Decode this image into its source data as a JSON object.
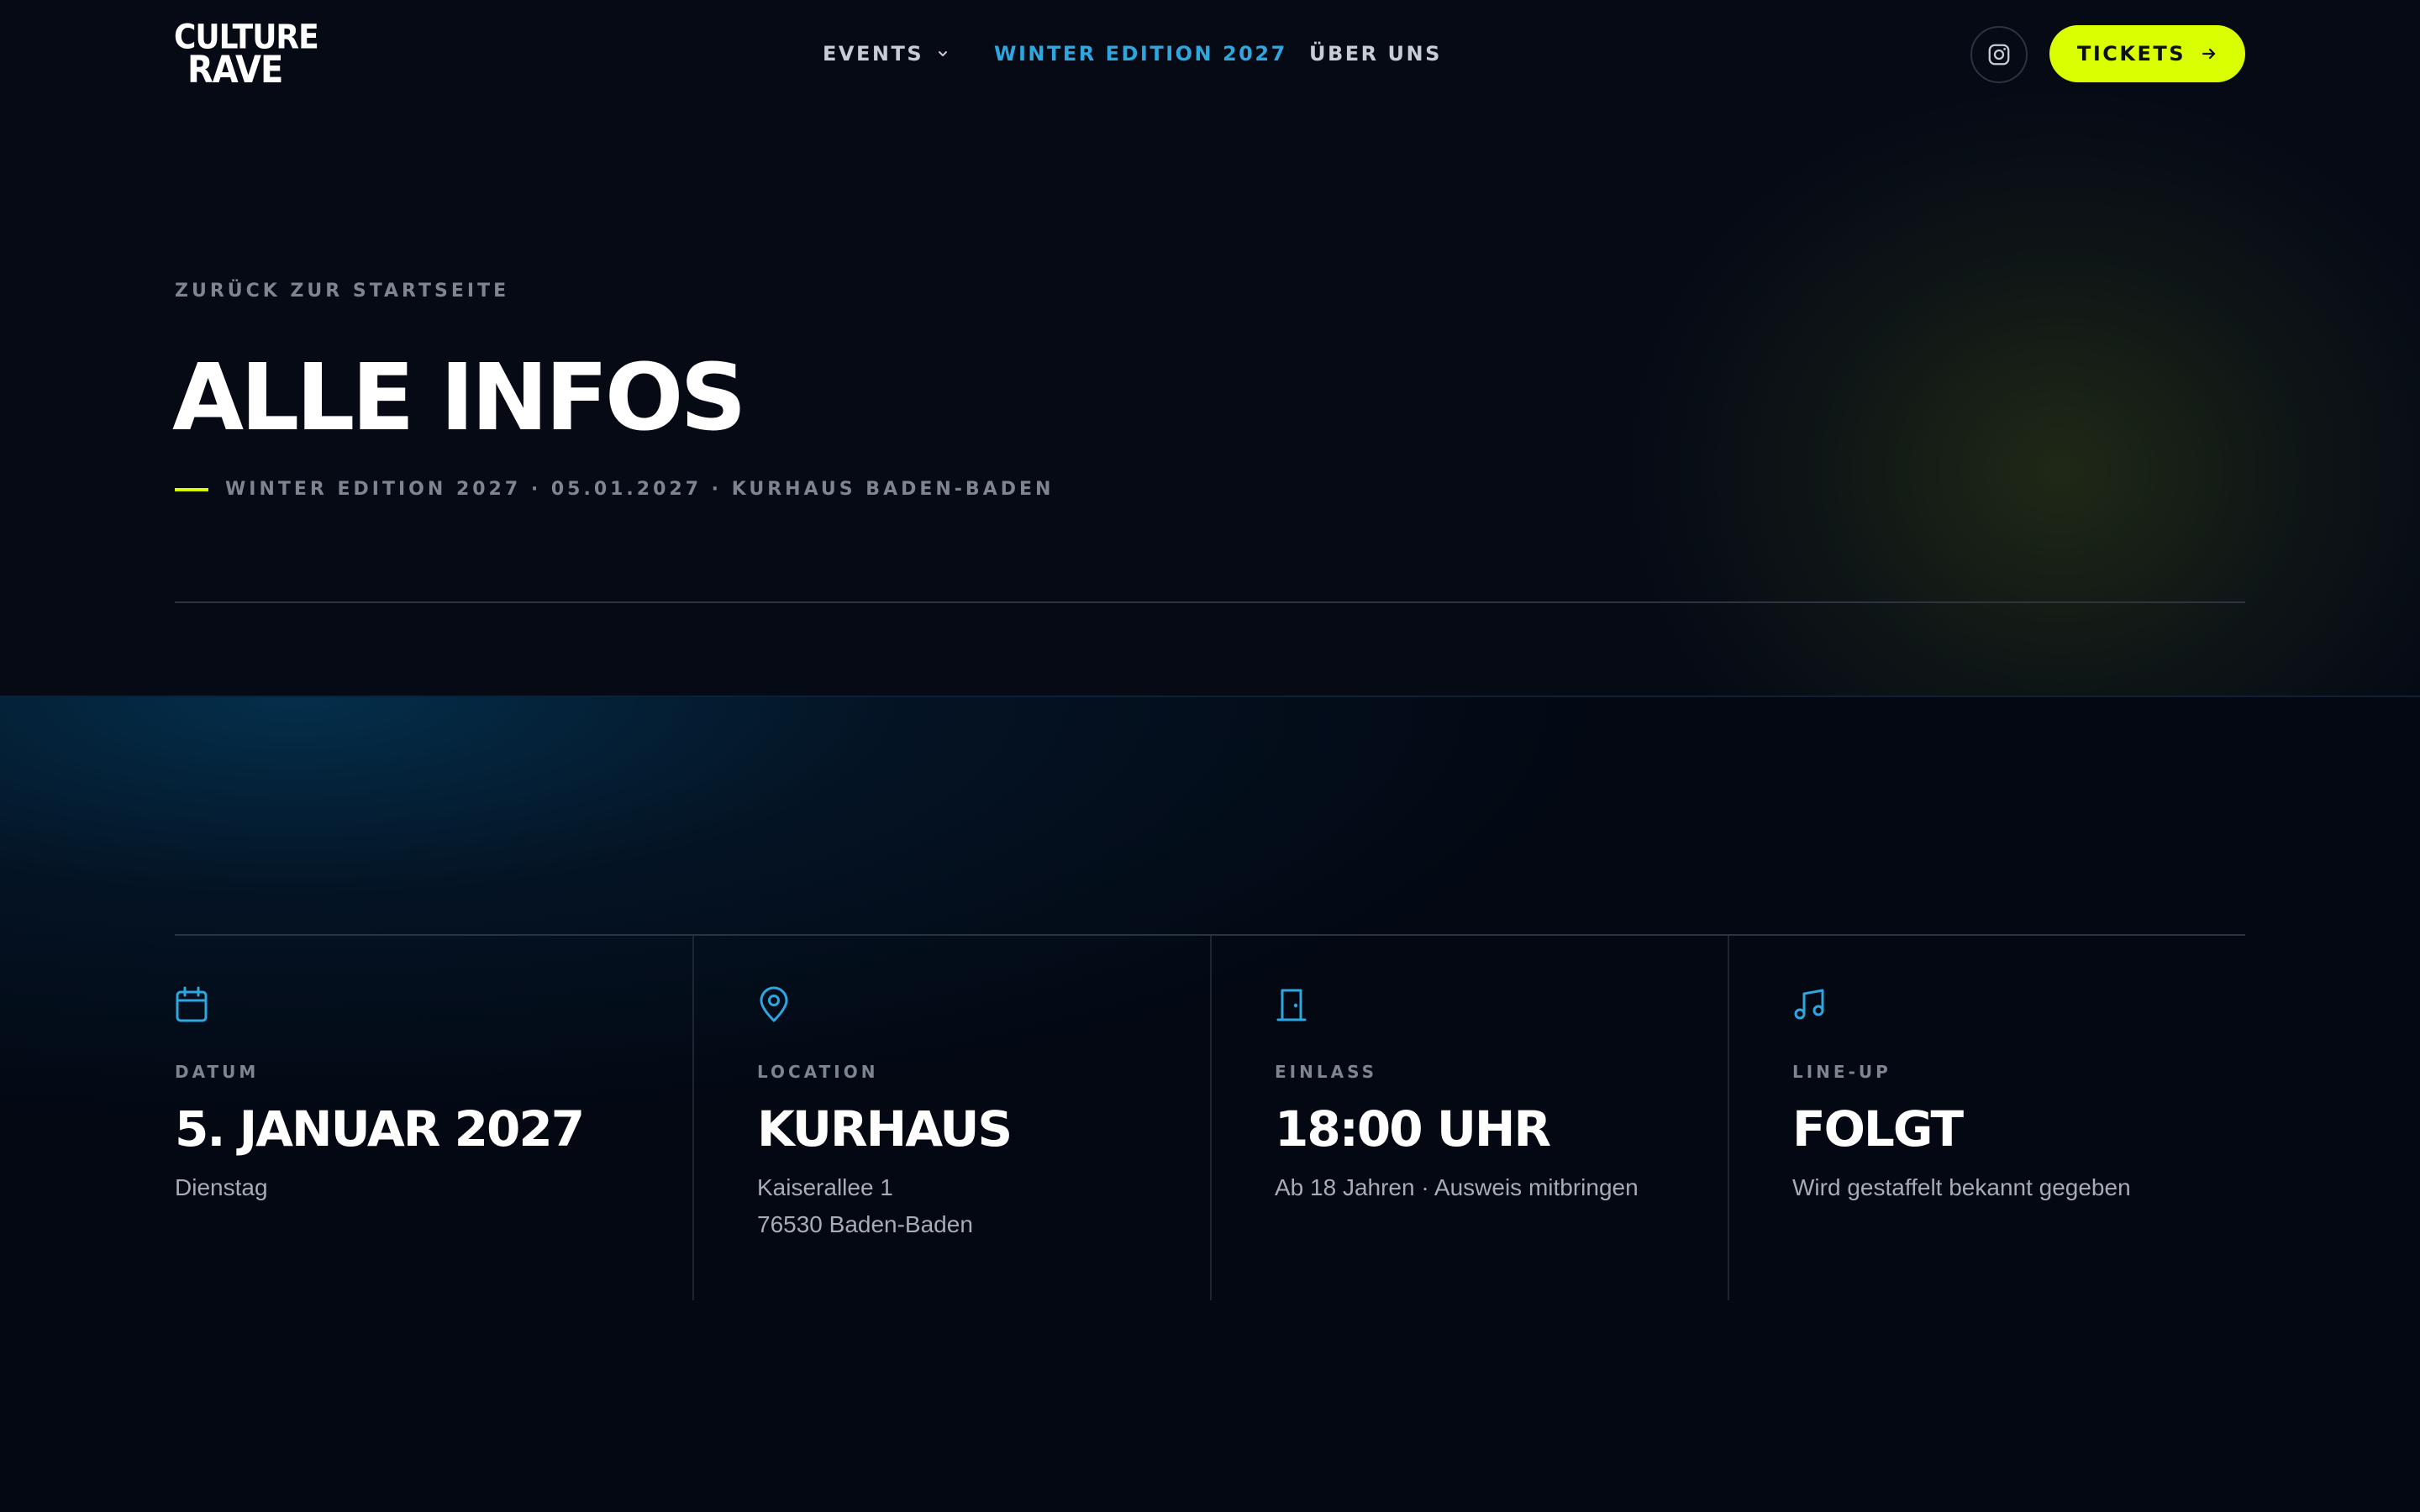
{
  "brand": {
    "logo_line1": "CULTURE",
    "logo_line2": "RAVE"
  },
  "nav": {
    "events_label": "EVENTS",
    "winter_label": "WINTER EDITION 2027",
    "ueber_label": "ÜBER UNS",
    "active_color": "#2ea7e0"
  },
  "header": {
    "instagram_icon": "instagram-icon",
    "tickets_label": "TICKETS",
    "tickets_color": "#d9ff00"
  },
  "hero": {
    "back_label": "ZURÜCK ZUR STARTSEITE",
    "title": "ALLE INFOS",
    "subline": "WINTER EDITION 2027 · 05.01.2027 · KURHAUS BADEN-BADEN"
  },
  "info": {
    "cards": [
      {
        "icon": "calendar-icon",
        "label": "DATUM",
        "value": "5. JANUAR 2027",
        "sub": [
          "Dienstag"
        ]
      },
      {
        "icon": "map-pin-icon",
        "label": "LOCATION",
        "value": "KURHAUS",
        "sub": [
          "Kaiserallee 1",
          "76530 Baden-Baden"
        ]
      },
      {
        "icon": "door-icon",
        "label": "EINLASS",
        "value": "18:00 UHR",
        "sub": [
          "Ab 18 Jahren · Ausweis mitbringen"
        ]
      },
      {
        "icon": "music-icon",
        "label": "LINE-UP",
        "value": "FOLGT",
        "sub": [
          "Wird gestaffelt bekannt gegeben"
        ]
      }
    ],
    "icon_color": "#2ea7e0"
  }
}
